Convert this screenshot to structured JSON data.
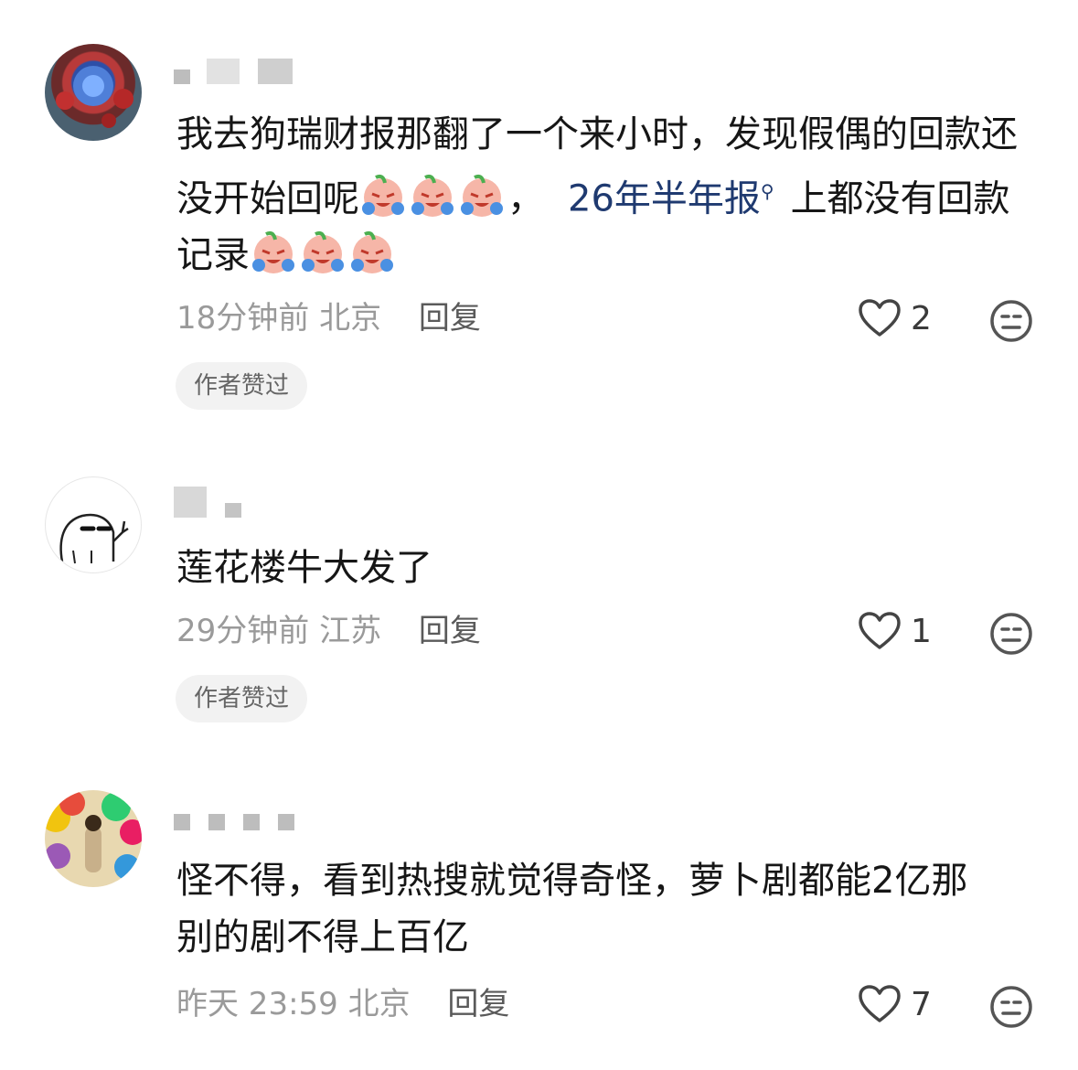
{
  "comments": [
    {
      "text_parts": [
        "我去狗瑞财报那翻了一个来小时，发现假偶的回款还没开始回呢",
        "，",
        "26年半年报",
        "上都没有回款记录"
      ],
      "meta": {
        "time": "18分钟前",
        "location": "北京",
        "reply": "回复"
      },
      "likes": "2",
      "tag": "作者赞过"
    },
    {
      "text": "莲花楼牛大发了",
      "meta": {
        "time": "29分钟前",
        "location": "江苏",
        "reply": "回复"
      },
      "likes": "1",
      "tag": "作者赞过"
    },
    {
      "text_lines": [
        "怪不得，看到热搜就觉得奇怪，萝卜剧都能2亿那",
        "别的剧不得上百亿"
      ],
      "meta": {
        "time": "昨天 23:59",
        "location": "北京",
        "reply": "回复"
      },
      "likes": "7"
    }
  ],
  "icons": {
    "heart": "heart-outline-icon",
    "meh": "neutral-face-icon",
    "search": "search-icon"
  },
  "colors": {
    "link": "#1f3a70",
    "meta": "#9a9a9a",
    "tag_bg": "#f2f2f2"
  }
}
